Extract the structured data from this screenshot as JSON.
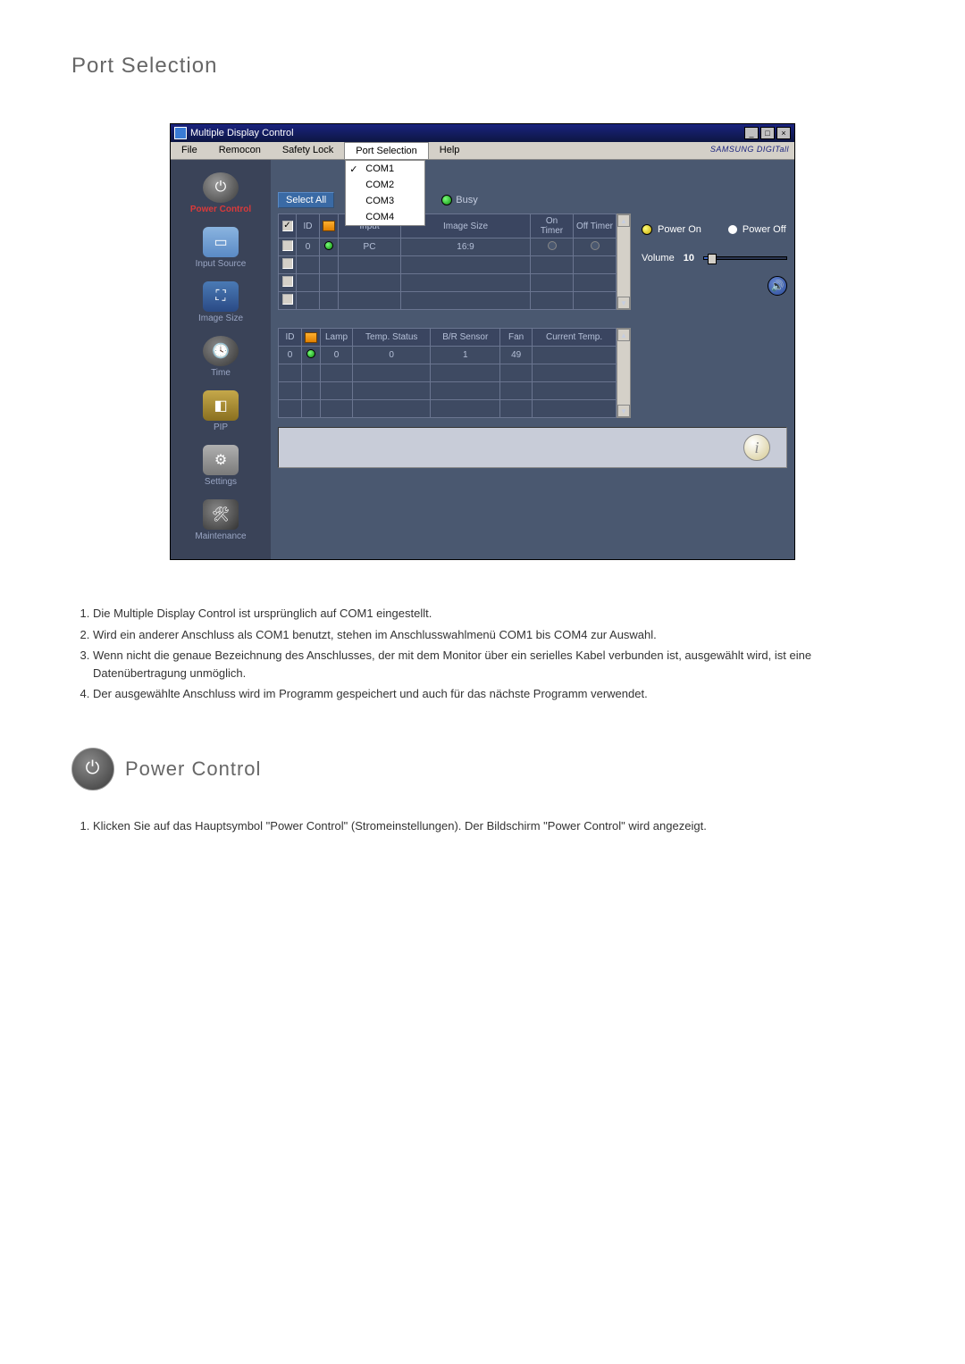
{
  "page": {
    "title": "Port Selection",
    "section2_title": "Power Control"
  },
  "window": {
    "title": "Multiple Display Control",
    "brand": "SAMSUNG DIGITall"
  },
  "menubar": [
    "File",
    "Remocon",
    "Safety Lock",
    "Port Selection",
    "Help"
  ],
  "port_dropdown": {
    "items": [
      "COM1",
      "COM2",
      "COM3",
      "COM4"
    ],
    "checked_index": 0
  },
  "sidebar": [
    {
      "label": "Power Control",
      "icon": "power",
      "active": true
    },
    {
      "label": "Input Source",
      "icon": "input"
    },
    {
      "label": "Image Size",
      "icon": "image"
    },
    {
      "label": "Time",
      "icon": "time"
    },
    {
      "label": "PIP",
      "icon": "pip"
    },
    {
      "label": "Settings",
      "icon": "settings"
    },
    {
      "label": "Maintenance",
      "icon": "maintenance"
    }
  ],
  "controls": {
    "select_all": "Select All",
    "busy": "Busy"
  },
  "table1": {
    "headers": [
      "",
      "ID",
      "",
      "Input",
      "Image Size",
      "On Timer",
      "Off Timer"
    ],
    "rows": [
      {
        "checked": false,
        "id": "0",
        "status": "green",
        "input": "PC",
        "image_size": "16:9",
        "on_timer": "○",
        "off_timer": "○"
      },
      {
        "checked": false,
        "id": "",
        "status": "",
        "input": "",
        "image_size": "",
        "on_timer": "",
        "off_timer": ""
      },
      {
        "checked": false,
        "id": "",
        "status": "",
        "input": "",
        "image_size": "",
        "on_timer": "",
        "off_timer": ""
      },
      {
        "checked": false,
        "id": "",
        "status": "",
        "input": "",
        "image_size": "",
        "on_timer": "",
        "off_timer": ""
      }
    ]
  },
  "table2": {
    "headers": [
      "ID",
      "",
      "Lamp",
      "Temp. Status",
      "B/R Sensor",
      "Fan",
      "Current Temp."
    ],
    "rows": [
      {
        "id": "0",
        "status": "green",
        "lamp": "0",
        "temp_status": "0",
        "br_sensor": "1",
        "fan": "49",
        "current_temp": ""
      },
      {
        "id": "",
        "status": "",
        "lamp": "",
        "temp_status": "",
        "br_sensor": "",
        "fan": "",
        "current_temp": ""
      },
      {
        "id": "",
        "status": "",
        "lamp": "",
        "temp_status": "",
        "br_sensor": "",
        "fan": "",
        "current_temp": ""
      },
      {
        "id": "",
        "status": "",
        "lamp": "",
        "temp_status": "",
        "br_sensor": "",
        "fan": "",
        "current_temp": ""
      }
    ]
  },
  "power_panel": {
    "power_on": "Power On",
    "power_off": "Power Off",
    "volume_label": "Volume",
    "volume_value": "10",
    "volume_percent": 10
  },
  "doc_list1": [
    "Die Multiple Display Control ist ursprünglich auf COM1 eingestellt.",
    "Wird ein anderer Anschluss als COM1 benutzt, stehen im Anschlusswahlmenü COM1 bis COM4 zur Auswahl.",
    "Wenn nicht die genaue Bezeichnung des Anschlusses, der mit dem Monitor über ein serielles Kabel verbunden ist, ausgewählt wird, ist eine Datenübertragung unmöglich.",
    "Der ausgewählte Anschluss wird im Programm gespeichert und auch für das nächste Programm verwendet."
  ],
  "doc_list2": [
    "Klicken Sie auf das Hauptsymbol \"Power Control\" (Stromeinstellungen). Der Bildschirm \"Power Control\" wird angezeigt."
  ]
}
